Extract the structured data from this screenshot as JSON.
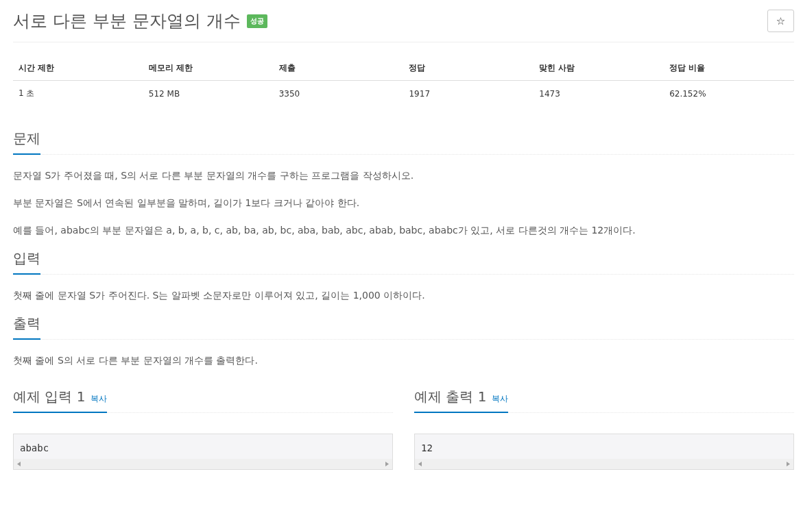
{
  "title": "서로 다른 부분 문자열의 개수",
  "badge": "성공",
  "star_button": "☆",
  "stats": {
    "columns": [
      "시간 제한",
      "메모리 제한",
      "제출",
      "정답",
      "맞힌 사람",
      "정답 비율"
    ],
    "rows": [
      [
        "1 초",
        "512 MB",
        "3350",
        "1917",
        "1473",
        "62.152%"
      ]
    ]
  },
  "sections": [
    {
      "heading": "문제",
      "paragraphs": [
        "문자열 S가 주어졌을 때, S의 서로 다른 부분 문자열의 개수를 구하는 프로그램을 작성하시오.",
        "부분 문자열은 S에서 연속된 일부분을 말하며, 길이가 1보다 크거나 같아야 한다.",
        "예를 들어, ababc의 부분 문자열은 a, b, a, b, c, ab, ba, ab, bc, aba, bab, abc, abab, babc, ababc가 있고, 서로 다른것의 개수는 12개이다."
      ]
    },
    {
      "heading": "입력",
      "paragraphs": [
        "첫째 줄에 문자열 S가 주어진다. S는 알파벳 소문자로만 이루어져 있고, 길이는 1,000 이하이다."
      ]
    },
    {
      "heading": "출력",
      "paragraphs": [
        "첫째 줄에 S의 서로 다른 부분 문자열의 개수를 출력한다."
      ]
    }
  ],
  "samples": [
    {
      "heading": "예제 입력 1",
      "copy": "복사",
      "content": "ababc"
    },
    {
      "heading": "예제 출력 1",
      "copy": "복사",
      "content": "12"
    }
  ]
}
